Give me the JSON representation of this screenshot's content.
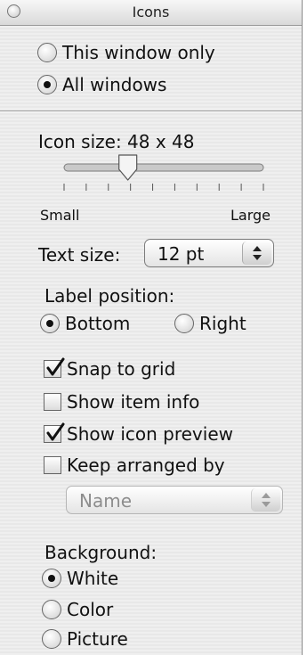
{
  "window": {
    "title": "Icons"
  },
  "scope": {
    "options": [
      {
        "label": "This window only",
        "selected": false
      },
      {
        "label": "All windows",
        "selected": true
      }
    ]
  },
  "icon_size": {
    "label": "Icon size: 48 x 48",
    "value": 48,
    "min_label": "Small",
    "max_label": "Large",
    "slider_fraction": 0.32
  },
  "text_size": {
    "label": "Text size:",
    "value": "12 pt"
  },
  "label_position": {
    "label": "Label position:",
    "options": [
      {
        "label": "Bottom",
        "selected": true
      },
      {
        "label": "Right",
        "selected": false
      }
    ]
  },
  "checkboxes": [
    {
      "label": "Snap to grid",
      "checked": true
    },
    {
      "label": "Show item info",
      "checked": false
    },
    {
      "label": "Show icon preview",
      "checked": true
    },
    {
      "label": "Keep arranged by",
      "checked": false
    }
  ],
  "arrange_by": {
    "value": "Name",
    "enabled": false
  },
  "background": {
    "label": "Background:",
    "options": [
      {
        "label": "White",
        "selected": true
      },
      {
        "label": "Color",
        "selected": false
      },
      {
        "label": "Picture",
        "selected": false
      }
    ]
  }
}
